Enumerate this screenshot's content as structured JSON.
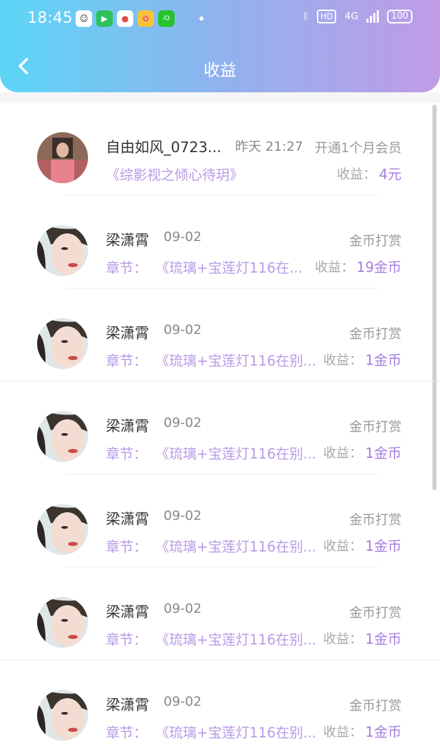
{
  "status_bar": {
    "time": "18:45",
    "network": "4G",
    "hd": "HD",
    "battery": "100"
  },
  "header": {
    "title": "收益"
  },
  "records": [
    {
      "name": "自由如风_0723...",
      "date": "昨天 21:27",
      "type": "开通1个月会员",
      "chapter_label": "",
      "chapter": "《综影视之倾心待玥》",
      "earn_label": "收益：",
      "earn_value": "4元"
    },
    {
      "name": "梁潇霄",
      "date": "09-02",
      "type": "金币打赏",
      "chapter_label": "章节：",
      "chapter": "《琉璃+宝莲灯116在...",
      "earn_label": "收益：",
      "earn_value": "19金币"
    },
    {
      "name": "梁潇霄",
      "date": "09-02",
      "type": "金币打赏",
      "chapter_label": "章节：",
      "chapter": "《琉璃+宝莲灯116在别...",
      "earn_label": "收益：",
      "earn_value": "1金币"
    },
    {
      "name": "梁潇霄",
      "date": "09-02",
      "type": "金币打赏",
      "chapter_label": "章节：",
      "chapter": "《琉璃+宝莲灯116在别...",
      "earn_label": "收益：",
      "earn_value": "1金币"
    },
    {
      "name": "梁潇霄",
      "date": "09-02",
      "type": "金币打赏",
      "chapter_label": "章节：",
      "chapter": "《琉璃+宝莲灯116在别...",
      "earn_label": "收益：",
      "earn_value": "1金币"
    },
    {
      "name": "梁潇霄",
      "date": "09-02",
      "type": "金币打赏",
      "chapter_label": "章节：",
      "chapter": "《琉璃+宝莲灯116在别...",
      "earn_label": "收益：",
      "earn_value": "1金币"
    },
    {
      "name": "梁潇霄",
      "date": "09-02",
      "type": "金币打赏",
      "chapter_label": "章节：",
      "chapter": "《琉璃+宝莲灯116在别...",
      "earn_label": "收益：",
      "earn_value": "1金币"
    }
  ]
}
